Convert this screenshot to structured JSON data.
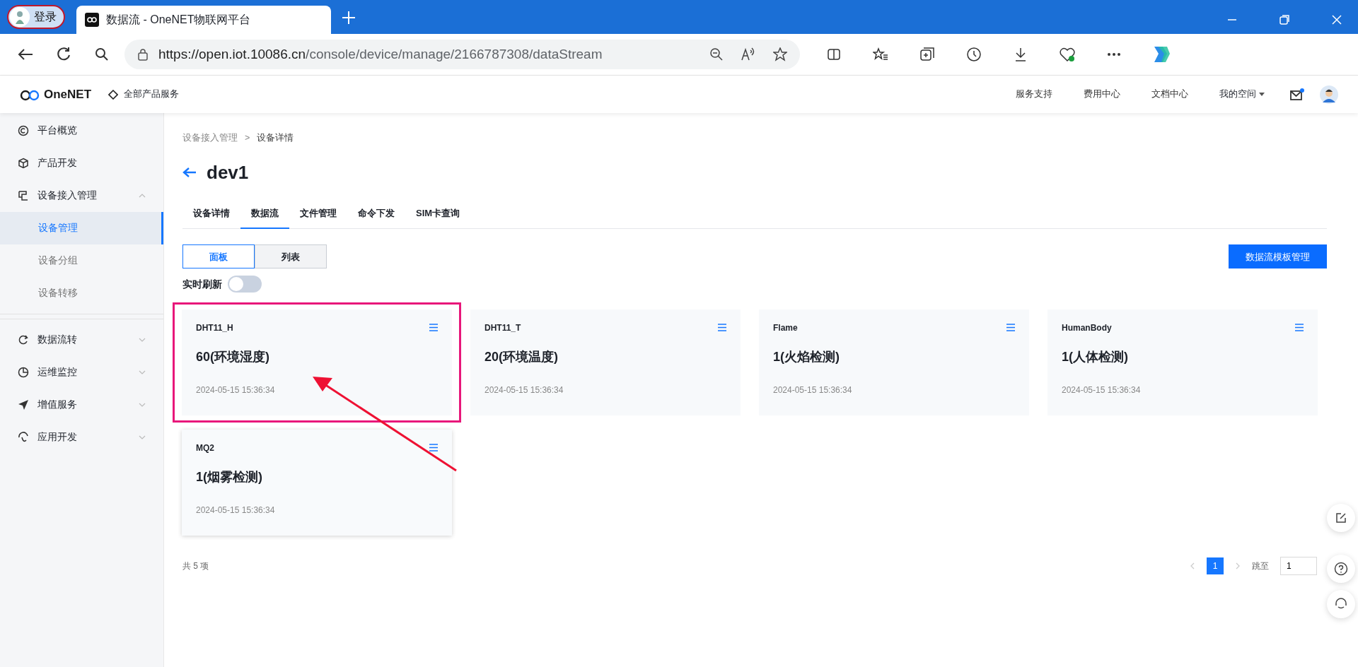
{
  "browser": {
    "profile": "登录",
    "tab_title": "数据流 - OneNET物联网平台",
    "url_host": "https://open.iot.10086.cn",
    "url_path": "/console/device/manage/2166787308/dataStream"
  },
  "header": {
    "logo": "OneNET",
    "products": "全部产品服务",
    "links": [
      "服务支持",
      "费用中心",
      "文档中心"
    ],
    "my_space": "我的空间",
    "mail_unread": true
  },
  "sidebar": {
    "items": [
      {
        "label": "平台概览"
      },
      {
        "label": "产品开发"
      },
      {
        "label": "设备接入管理",
        "expanded": true,
        "children": [
          {
            "label": "设备管理",
            "selected": true
          },
          {
            "label": "设备分组",
            "selected": false
          },
          {
            "label": "设备转移",
            "selected": false
          }
        ]
      },
      {
        "label": "数据流转",
        "expanded": false
      },
      {
        "label": "运维监控",
        "expanded": false
      },
      {
        "label": "增值服务",
        "expanded": false
      },
      {
        "label": "应用开发",
        "expanded": false
      }
    ]
  },
  "breadcrumb": [
    "设备接入管理",
    "设备详情"
  ],
  "breadcrumb_separator": ">",
  "title": "dev1",
  "tabs": [
    {
      "label": "设备详情",
      "selected": false
    },
    {
      "label": "数据流",
      "selected": true
    },
    {
      "label": "文件管理",
      "selected": false
    },
    {
      "label": "命令下发",
      "selected": false
    },
    {
      "label": "SIM卡查询",
      "selected": false
    }
  ],
  "view_modes": [
    {
      "label": "面板",
      "selected": true
    },
    {
      "label": "列表",
      "selected": false
    }
  ],
  "template_button": "数据流模板管理",
  "realtime_refresh": {
    "label": "实时刷新",
    "on": false
  },
  "cards": [
    {
      "name": "DHT11_H",
      "value": "60(环境湿度)",
      "time": "2024-05-15 15:36:34",
      "highlighted": true,
      "hovered": false
    },
    {
      "name": "DHT11_T",
      "value": "20(环境温度)",
      "time": "2024-05-15 15:36:34",
      "highlighted": false,
      "hovered": false
    },
    {
      "name": "Flame",
      "value": "1(火焰检测)",
      "time": "2024-05-15 15:36:34",
      "highlighted": false,
      "hovered": false
    },
    {
      "name": "HumanBody",
      "value": "1(人体检测)",
      "time": "2024-05-15 15:36:34",
      "highlighted": false,
      "hovered": false
    },
    {
      "name": "MQ2",
      "value": "1(烟雾检测)",
      "time": "2024-05-15 15:36:34",
      "highlighted": false,
      "hovered": true
    }
  ],
  "pagination": {
    "total": "共 5 项",
    "pages": [
      {
        "label": "1",
        "selected": true
      }
    ],
    "jump_label": "跳至",
    "jump_value": "1"
  }
}
